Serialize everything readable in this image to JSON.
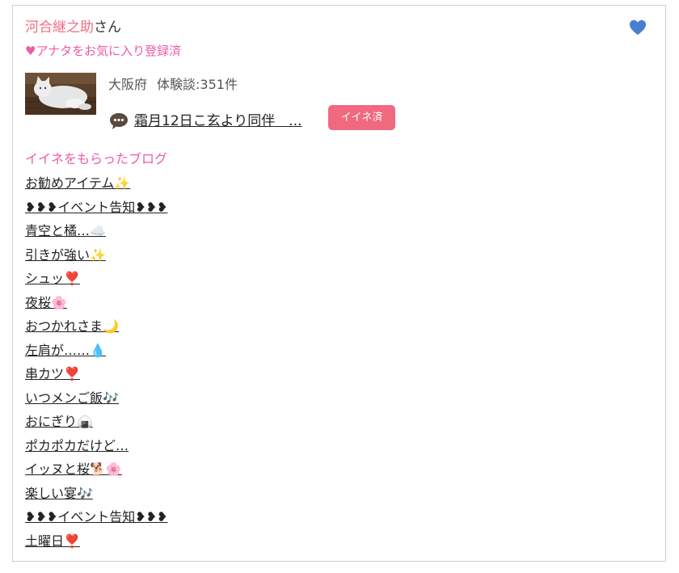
{
  "user": {
    "name": "河合継之助",
    "suffix": "さん",
    "favorite_status": "♥アナタをお気に入り登録済",
    "favorite_icon": "blue-heart-icon",
    "favorite_icon_color": "#4a7fcf"
  },
  "profile": {
    "region": "大阪府",
    "experience_label": "体験談:351件"
  },
  "review": {
    "icon": "speech-bubble-icon",
    "title": "霜月12日こ玄より同伴　...",
    "like_button_label": "イイネ済"
  },
  "blog_section": {
    "heading": "イイネをもらったブログ",
    "items": [
      {
        "label": "お勧めアイテム✨"
      },
      {
        "label": "❥❥❥イベント告知❥❥❥"
      },
      {
        "label": "青空と橘…☁️"
      },
      {
        "label": "引きが強い✨"
      },
      {
        "label": "シュッ❣️"
      },
      {
        "label": "夜桜🌸"
      },
      {
        "label": "おつかれさま🌙"
      },
      {
        "label": "左肩が……💧"
      },
      {
        "label": "串カツ❣️"
      },
      {
        "label": "いつメンご飯🎶"
      },
      {
        "label": "おにぎり🍙"
      },
      {
        "label": "ポカポカだけど…"
      },
      {
        "label": "イッヌと桜🐕🌸"
      },
      {
        "label": "楽しい宴🎶"
      },
      {
        "label": "❥❥❥イベント告知❥❥❥"
      },
      {
        "label": "土曜日❣️"
      }
    ]
  },
  "colors": {
    "name_pink": "#ee6e86",
    "accent_pink": "#ee5aaa",
    "button_pink": "#f0697f",
    "border": "#cfcfcf"
  }
}
